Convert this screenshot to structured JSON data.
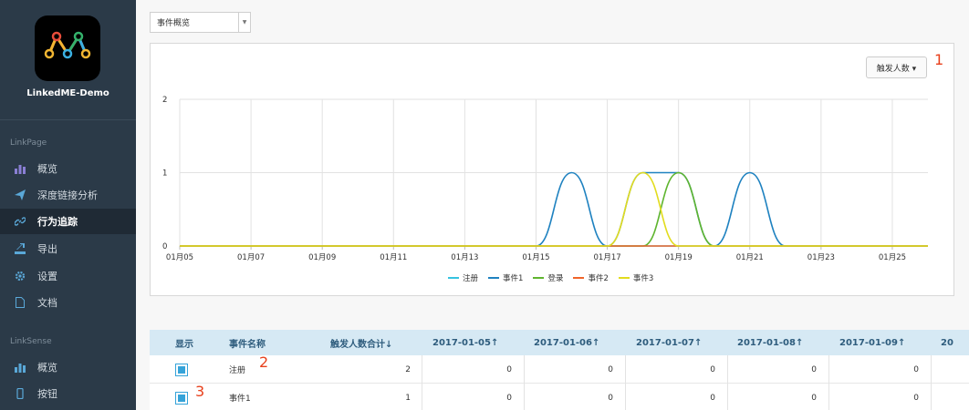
{
  "sidebar": {
    "app_name": "LinkedME-Demo",
    "sections": [
      {
        "label": "LinkPage"
      },
      {
        "label": "LinkSense"
      }
    ],
    "linkpage_items": [
      {
        "label": "概览",
        "icon": "bar-chart-icon"
      },
      {
        "label": "深度链接分析",
        "icon": "send-icon"
      },
      {
        "label": "行为追踪",
        "icon": "link-icon",
        "active": true
      },
      {
        "label": "导出",
        "icon": "export-icon"
      },
      {
        "label": "设置",
        "icon": "gear-icon"
      },
      {
        "label": "文档",
        "icon": "document-icon"
      }
    ],
    "linksense_items": [
      {
        "label": "概览",
        "icon": "bar-chart-icon"
      },
      {
        "label": "按钮",
        "icon": "phone-icon"
      }
    ]
  },
  "filter": {
    "selected": "事件概览"
  },
  "metric_button": {
    "label": "触发人数 ▾"
  },
  "annotations": {
    "a1": "1",
    "a2": "2",
    "a3": "3"
  },
  "chart_data": {
    "type": "line",
    "x": [
      "01月05",
      "01月06",
      "01月07",
      "01月08",
      "01月09",
      "01月10",
      "01月11",
      "01月12",
      "01月13",
      "01月14",
      "01月15",
      "01月16",
      "01月17",
      "01月18",
      "01月19",
      "01月20",
      "01月21",
      "01月22",
      "01月23",
      "01月24",
      "01月25",
      "01月26"
    ],
    "xticks": [
      "01月05",
      "01月07",
      "01月09",
      "01月11",
      "01月13",
      "01月15",
      "01月17",
      "01月19",
      "01月21",
      "01月23",
      "01月25"
    ],
    "ylim": [
      0,
      2
    ],
    "yticks": [
      "0",
      "1",
      "2"
    ],
    "grid": true,
    "legend_position": "bottom",
    "series": [
      {
        "name": "注册",
        "color": "#36c3e0",
        "values": [
          0,
          0,
          0,
          0,
          0,
          0,
          0,
          0,
          0,
          0,
          0,
          0,
          0,
          0,
          0,
          0,
          0,
          0,
          0,
          0,
          0,
          0
        ]
      },
      {
        "name": "事件1",
        "color": "#1f82c0",
        "values": [
          0,
          0,
          0,
          0,
          0,
          0,
          0,
          0,
          0,
          0,
          0,
          1,
          0,
          1,
          1,
          0,
          1,
          0,
          0,
          0,
          0,
          0
        ]
      },
      {
        "name": "登录",
        "color": "#5fb52f",
        "values": [
          0,
          0,
          0,
          0,
          0,
          0,
          0,
          0,
          0,
          0,
          0,
          0,
          0,
          0,
          1,
          0,
          0,
          0,
          0,
          0,
          0,
          0
        ]
      },
      {
        "name": "事件2",
        "color": "#f0642a",
        "values": [
          0,
          0,
          0,
          0,
          0,
          0,
          0,
          0,
          0,
          0,
          0,
          0,
          0,
          0,
          0,
          0,
          0,
          0,
          0,
          0,
          0,
          0
        ]
      },
      {
        "name": "事件3",
        "color": "#e2dc1e",
        "values": [
          0,
          0,
          0,
          0,
          0,
          0,
          0,
          0,
          0,
          0,
          0,
          0,
          0,
          1,
          0,
          0,
          0,
          0,
          0,
          0,
          0,
          0
        ]
      }
    ]
  },
  "table": {
    "headers": [
      "显示",
      "事件名称",
      "触发人数合计↓",
      "2017-01-05↑",
      "2017-01-06↑",
      "2017-01-07↑",
      "2017-01-08↑",
      "2017-01-09↑",
      "20"
    ],
    "rows": [
      {
        "checked": true,
        "name": "注册",
        "total": "2",
        "values": [
          "0",
          "0",
          "0",
          "0",
          "0"
        ]
      },
      {
        "checked": true,
        "name": "事件1",
        "total": "1",
        "values": [
          "0",
          "0",
          "0",
          "0",
          "0"
        ]
      }
    ]
  }
}
